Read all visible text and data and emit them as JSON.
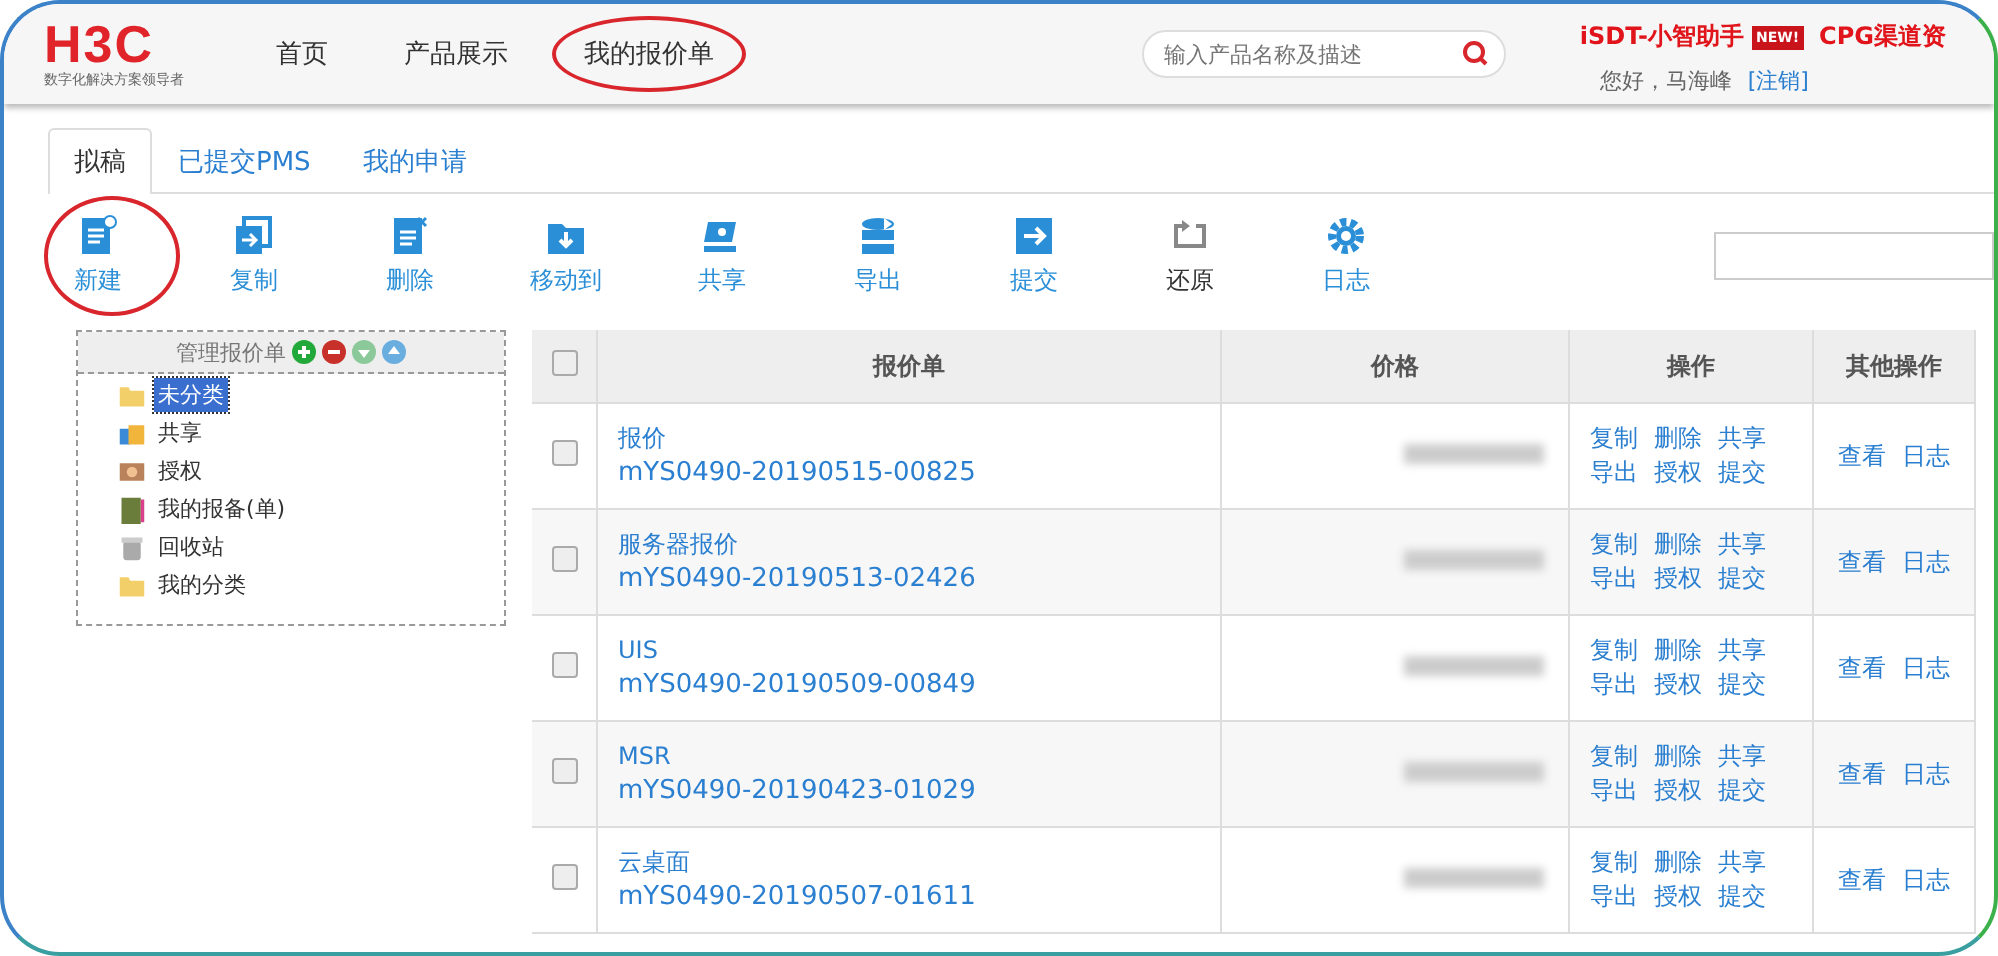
{
  "header": {
    "logo": {
      "brand": "H3C",
      "tagline": "数字化解决方案领导者"
    },
    "nav": [
      {
        "label": "首页",
        "circled": false
      },
      {
        "label": "产品展示",
        "circled": false
      },
      {
        "label": "我的报价单",
        "circled": true
      }
    ],
    "search": {
      "placeholder": "输入产品名称及描述"
    },
    "promo_links": [
      {
        "label": "iSDT-小智助手",
        "badge": "NEW!"
      },
      {
        "label": "CPG渠道资"
      }
    ],
    "greeting": "您好，马海峰",
    "logout": "[注销]"
  },
  "tabs": [
    {
      "label": "拟稿",
      "selected": true
    },
    {
      "label": "已提交PMS",
      "selected": false
    },
    {
      "label": "我的申请",
      "selected": false
    }
  ],
  "toolbar": [
    {
      "label": "新建",
      "kind": "new",
      "circled": true,
      "disabled": false
    },
    {
      "label": "复制",
      "kind": "copy",
      "circled": false,
      "disabled": false
    },
    {
      "label": "删除",
      "kind": "delete",
      "circled": false,
      "disabled": false
    },
    {
      "label": "移动到",
      "kind": "move",
      "circled": false,
      "disabled": false
    },
    {
      "label": "共享",
      "kind": "share",
      "circled": false,
      "disabled": false
    },
    {
      "label": "导出",
      "kind": "export",
      "circled": false,
      "disabled": false
    },
    {
      "label": "提交",
      "kind": "submit",
      "circled": false,
      "disabled": false
    },
    {
      "label": "还原",
      "kind": "restore",
      "circled": false,
      "disabled": true
    },
    {
      "label": "日志",
      "kind": "log",
      "circled": false,
      "disabled": false
    }
  ],
  "tree": {
    "title": "管理报价单",
    "items": [
      {
        "label": "未分类",
        "kind": "folder",
        "selected": true
      },
      {
        "label": "共享",
        "kind": "share",
        "selected": false
      },
      {
        "label": "授权",
        "kind": "grant",
        "selected": false
      },
      {
        "label": "我的报备(单)",
        "kind": "book",
        "selected": false
      },
      {
        "label": "回收站",
        "kind": "trash",
        "selected": false
      },
      {
        "label": "我的分类",
        "kind": "folder",
        "selected": false
      }
    ]
  },
  "table": {
    "columns": [
      "报价单",
      "价格",
      "操作",
      "其他操作"
    ],
    "select_all_checked": false,
    "rows": [
      {
        "name": "报价",
        "number": "mYS0490-20190515-00825",
        "checked": false,
        "actions": [
          "复制",
          "删除",
          "共享",
          "导出",
          "授权",
          "提交"
        ],
        "other_actions": [
          "查看",
          "日志"
        ]
      },
      {
        "name": "服务器报价",
        "number": "mYS0490-20190513-02426",
        "checked": false,
        "actions": [
          "复制",
          "删除",
          "共享",
          "导出",
          "授权",
          "提交"
        ],
        "other_actions": [
          "查看",
          "日志"
        ]
      },
      {
        "name": "UIS",
        "number": "mYS0490-20190509-00849",
        "checked": false,
        "actions": [
          "复制",
          "删除",
          "共享",
          "导出",
          "授权",
          "提交"
        ],
        "other_actions": [
          "查看",
          "日志"
        ]
      },
      {
        "name": "MSR",
        "number": "mYS0490-20190423-01029",
        "checked": false,
        "actions": [
          "复制",
          "删除",
          "共享",
          "导出",
          "授权",
          "提交"
        ],
        "other_actions": [
          "查看",
          "日志"
        ]
      },
      {
        "name": "云桌面",
        "number": "mYS0490-20190507-01611",
        "checked": false,
        "actions": [
          "复制",
          "删除",
          "共享",
          "导出",
          "授权",
          "提交"
        ],
        "other_actions": [
          "查看",
          "日志"
        ]
      }
    ]
  }
}
